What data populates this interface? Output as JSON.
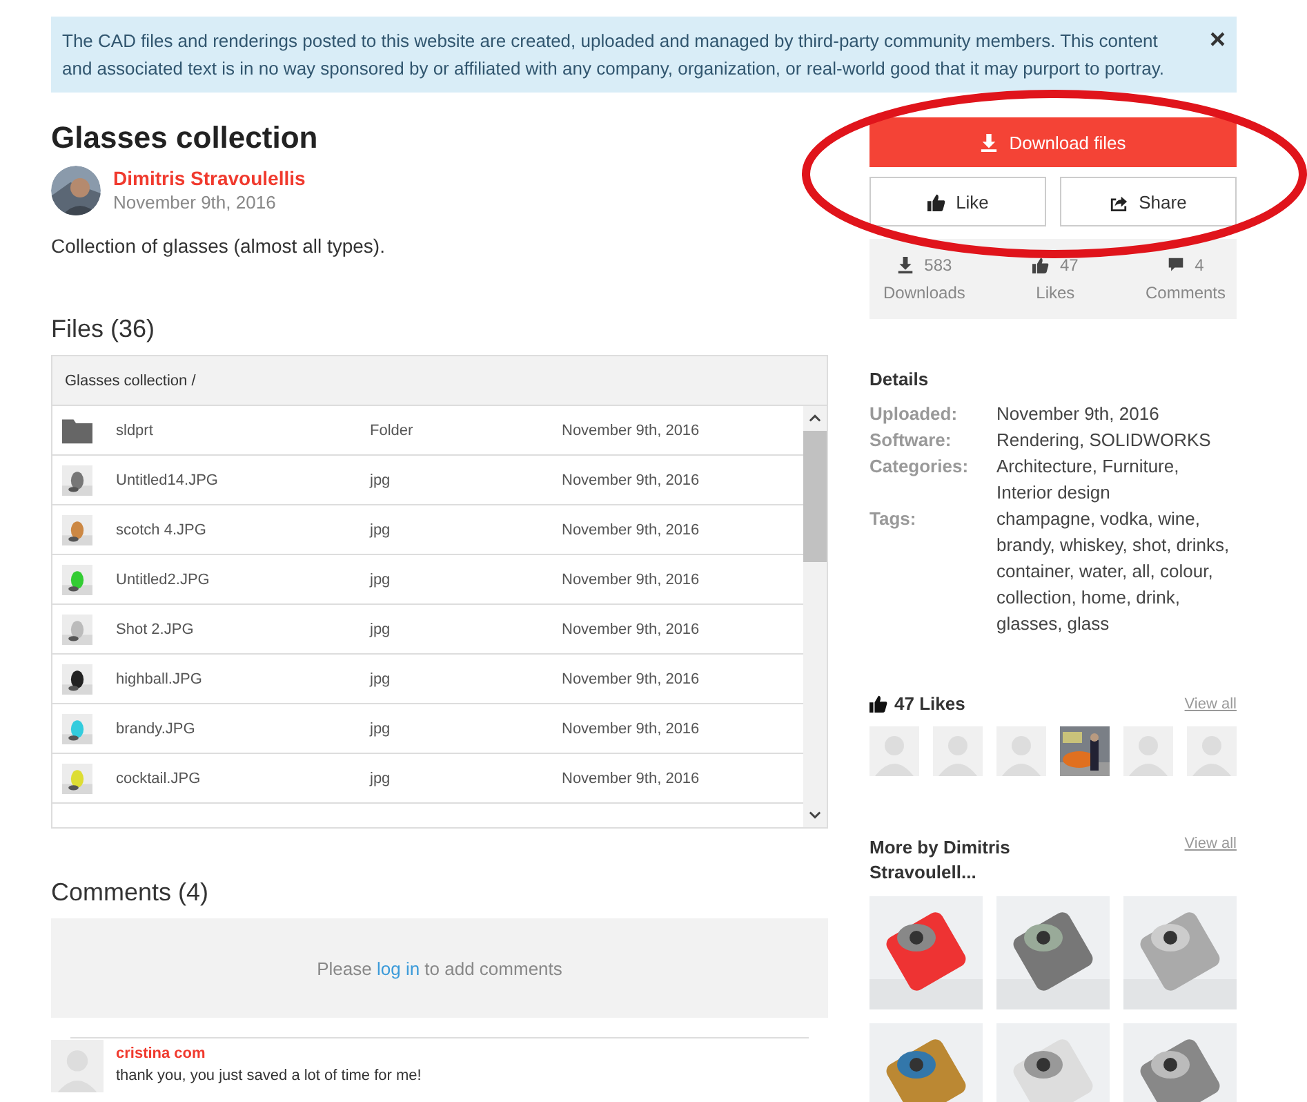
{
  "notice": {
    "text": "The CAD files and renderings posted to this website are created, uploaded and managed by third-party community members. This content and associated text is in no way sponsored by or affiliated with any company, organization, or real-world good that it may purport to portray.",
    "close": "×"
  },
  "model": {
    "title": "Glasses collection",
    "author": "Dimitris Stravoulellis",
    "date": "November 9th, 2016",
    "description": "Collection of glasses (almost all types)."
  },
  "actions": {
    "download": "Download files",
    "like": "Like",
    "share": "Share"
  },
  "stats": [
    {
      "kind": "downloads",
      "count": "583",
      "label": "Downloads"
    },
    {
      "kind": "likes",
      "count": "47",
      "label": "Likes"
    },
    {
      "kind": "comments",
      "count": "4",
      "label": "Comments"
    }
  ],
  "files": {
    "heading": "Files (36)",
    "path": "Glasses collection /",
    "rows": [
      {
        "kind": "folder",
        "name": "sldprt",
        "type": "Folder",
        "date": "November 9th, 2016"
      },
      {
        "name": "Untitled14.JPG",
        "type": "jpg",
        "date": "November 9th, 2016"
      },
      {
        "name": "scotch 4.JPG",
        "type": "jpg",
        "date": "November 9th, 2016"
      },
      {
        "name": "Untitled2.JPG",
        "type": "jpg",
        "date": "November 9th, 2016"
      },
      {
        "name": "Shot 2.JPG",
        "type": "jpg",
        "date": "November 9th, 2016"
      },
      {
        "name": "highball.JPG",
        "type": "jpg",
        "date": "November 9th, 2016"
      },
      {
        "name": "brandy.JPG",
        "type": "jpg",
        "date": "November 9th, 2016"
      },
      {
        "name": "cocktail.JPG",
        "type": "jpg",
        "date": "November 9th, 2016"
      }
    ]
  },
  "comments": {
    "heading": "Comments (4)",
    "prompt_before": "Please",
    "login_link": "log in",
    "prompt_after": "to add comments",
    "items": [
      {
        "author": "cristina com",
        "text": "thank you, you just saved a lot of time for me!"
      }
    ]
  },
  "details": {
    "heading": "Details",
    "rows": [
      {
        "label": "Uploaded:",
        "value": "November 9th, 2016"
      },
      {
        "label": "Software:",
        "value": "Rendering, SOLIDWORKS"
      },
      {
        "label": "Categories:",
        "value": "Architecture, Furniture, Interior design"
      },
      {
        "label": "Tags:",
        "value": "champagne, vodka, wine, brandy, whiskey, shot, drinks, container, water, all, colour, collection, home, drink, glasses, glass"
      }
    ]
  },
  "likes": {
    "heading": "47 Likes",
    "view_all": "View all",
    "users": [
      {
        "kind": "placeholder"
      },
      {
        "kind": "placeholder"
      },
      {
        "kind": "placeholder"
      },
      {
        "kind": "picture"
      },
      {
        "kind": "placeholder"
      },
      {
        "kind": "placeholder"
      }
    ]
  },
  "more_by": {
    "heading": "More by Dimitris Stravoulell...",
    "view_all": "View all",
    "items": [
      {
        "kind": "picture"
      },
      {
        "kind": "picture"
      },
      {
        "kind": "picture"
      },
      {
        "kind": "picture"
      },
      {
        "kind": "picture"
      },
      {
        "kind": "picture"
      }
    ]
  },
  "annotation": {
    "kind": "ellipse"
  }
}
